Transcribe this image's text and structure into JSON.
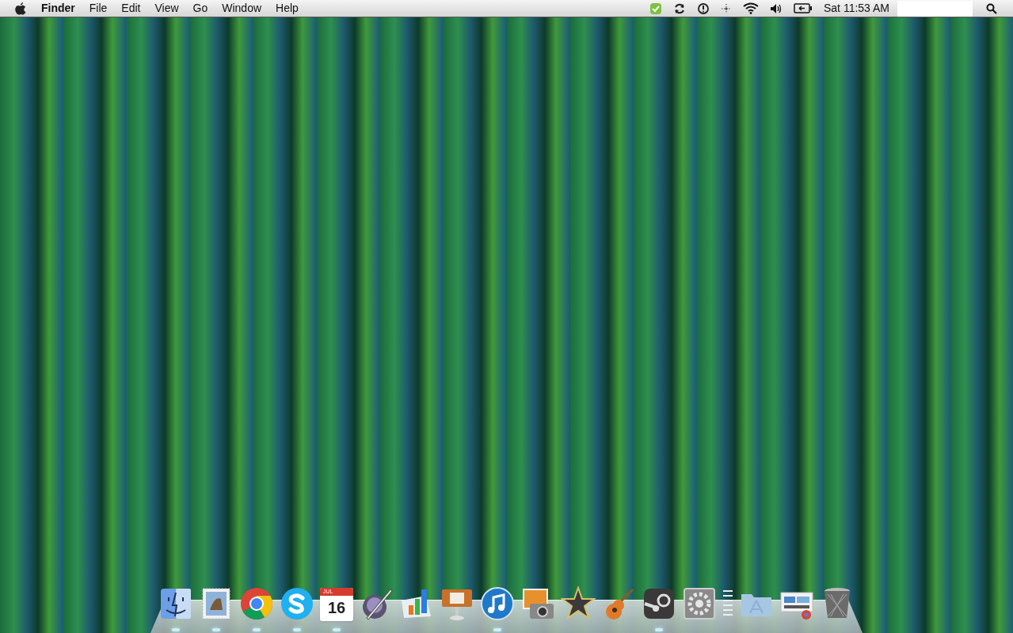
{
  "menu_bar": {
    "app_name": "Finder",
    "menus": [
      "File",
      "Edit",
      "View",
      "Go",
      "Window",
      "Help"
    ],
    "clock": "Sat 11:53 AM"
  },
  "dock": {
    "items": [
      {
        "kind": "finder",
        "running": true
      },
      {
        "kind": "mail",
        "running": true
      },
      {
        "kind": "chrome",
        "running": true
      },
      {
        "kind": "skype",
        "running": true
      },
      {
        "kind": "calendar",
        "running": true,
        "month": "JUL",
        "day": "16"
      },
      {
        "kind": "pen",
        "running": false
      },
      {
        "kind": "chart",
        "running": false
      },
      {
        "kind": "presentation",
        "running": false
      },
      {
        "kind": "music",
        "running": true
      },
      {
        "kind": "photos",
        "running": false
      },
      {
        "kind": "star",
        "running": false
      },
      {
        "kind": "guitar",
        "running": false
      },
      {
        "kind": "steam",
        "running": true
      },
      {
        "kind": "gears",
        "running": false
      },
      {
        "kind": "separator",
        "running": false
      },
      {
        "kind": "folder",
        "running": false
      },
      {
        "kind": "window",
        "running": false
      },
      {
        "kind": "trash",
        "running": false
      }
    ]
  }
}
